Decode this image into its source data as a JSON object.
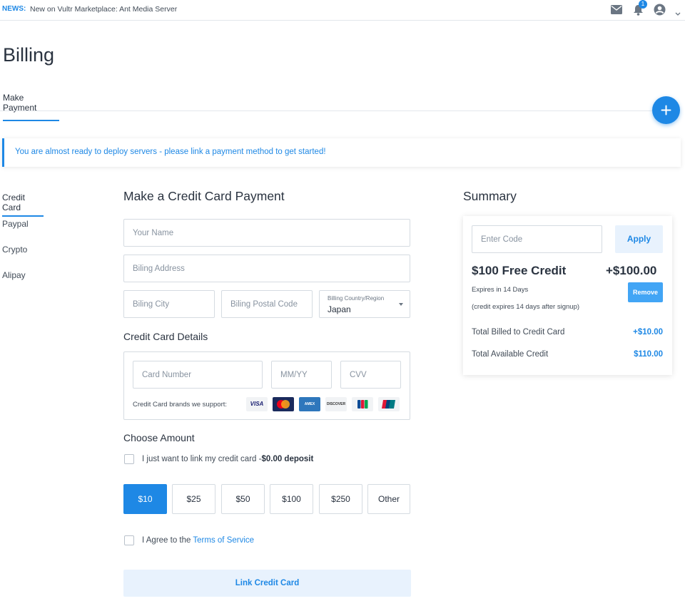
{
  "topbar": {
    "news_tag": "NEWS:",
    "news_text": "New on Vultr Marketplace: Ant Media Server",
    "notification_count": "1"
  },
  "page": {
    "title": "Billing",
    "tab": "Make Payment"
  },
  "notice": "You are almost ready to deploy servers - please link a payment method to get started!",
  "sidebar": {
    "items": [
      {
        "label": "Credit Card"
      },
      {
        "label": "Paypal"
      },
      {
        "label": "Crypto"
      },
      {
        "label": "Alipay"
      }
    ]
  },
  "form": {
    "title": "Make a Credit Card Payment",
    "name_placeholder": "Your Name",
    "address_placeholder": "Biling Address",
    "city_placeholder": "Biling City",
    "postal_placeholder": "Biling Postal Code",
    "country_label": "Billing Country/Region",
    "country_value": "Japan",
    "card_details_title": "Credit Card Details",
    "card_number_placeholder": "Card Number",
    "expiry_placeholder": "MM/YY",
    "cvv_placeholder": "CVV",
    "brands_label": "Credit Card brands we support:",
    "brands": [
      "VISA",
      "Mastercard",
      "AMEX",
      "DISCOVER",
      "JCB",
      "UnionPay"
    ],
    "choose_amount_title": "Choose Amount",
    "link_only_label": "I just want to link my credit card -",
    "link_only_bold": "$0.00 deposit",
    "amounts": [
      "$10",
      "$25",
      "$50",
      "$100",
      "$250",
      "Other"
    ],
    "selected_amount": "$10",
    "agree_text": "I Agree to the ",
    "terms_link": "Terms of Service",
    "submit_label": "Link Credit Card"
  },
  "summary": {
    "title": "Summary",
    "code_placeholder": "Enter Code",
    "apply_label": "Apply",
    "credit_title": "$100 Free Credit",
    "credit_amount": "+$100.00",
    "expires": "Expires in 14 Days",
    "expires_note": "(credit expires 14 days after signup)",
    "remove_label": "Remove",
    "billed_label": "Total Billed to Credit Card",
    "billed_value": "+$10.00",
    "available_label": "Total Available Credit",
    "available_value": "$110.00"
  },
  "colors": {
    "accent": "#1e88e5",
    "accent_light": "#e8f2fd",
    "text": "#414b57"
  }
}
